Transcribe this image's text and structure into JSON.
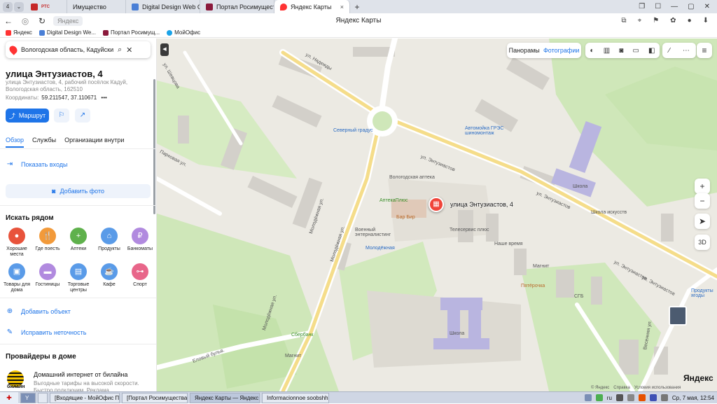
{
  "browser": {
    "tabs": [
      {
        "label": "",
        "badge": "PTC",
        "active": false
      },
      {
        "label": "Имущество",
        "active": false
      },
      {
        "label": "Digital Design Web Client",
        "active": false
      },
      {
        "label": "Портал Росимущества",
        "active": false
      },
      {
        "label": "Яндекс Карты",
        "active": true
      }
    ],
    "new_tab": "+",
    "site_chip": "Яндекс",
    "page_title": "Яндекс Карты",
    "bookmarks": [
      "Яндекс",
      "Digital Design We...",
      "Портал Росимущ...",
      "МойОфис"
    ]
  },
  "search": {
    "value": "Вологодская область, Кадуйский ра"
  },
  "place": {
    "title": "улица Энтузиастов, 4",
    "address": "улица Энтузиастов, 4, рабочий посёлок Кадуй, Вологодская область, 162510",
    "coords_label": "Координаты:",
    "coords_value": "59.211547, 37.110671",
    "more": "•••",
    "route_label": "Маршрут"
  },
  "tabs": [
    "Обзор",
    "Службы",
    "Организации внутри"
  ],
  "actions": {
    "show_entrances": "Показать входы",
    "add_photo": "Добавить фото",
    "add_object": "Добавить объект",
    "fix_error": "Исправить неточность"
  },
  "nearby": {
    "title": "Искать рядом",
    "categories": [
      {
        "label": "Хорошие места",
        "icon": "map-pin-icon",
        "color": "#e8533b"
      },
      {
        "label": "Где поесть",
        "icon": "food-icon",
        "color": "#f29a3a"
      },
      {
        "label": "Аптеки",
        "icon": "pharmacy-icon",
        "color": "#5fb14c"
      },
      {
        "label": "Продукты",
        "icon": "basket-icon",
        "color": "#5a9be8"
      },
      {
        "label": "Банкоматы",
        "icon": "ruble-icon",
        "color": "#b18adf"
      },
      {
        "label": "Товары для дома",
        "icon": "bag-icon",
        "color": "#5a9be8"
      },
      {
        "label": "Гостиницы",
        "icon": "bed-icon",
        "color": "#b18adf"
      },
      {
        "label": "Торговые центры",
        "icon": "mall-icon",
        "color": "#5a9be8"
      },
      {
        "label": "Кафе",
        "icon": "cup-icon",
        "color": "#5a9be8"
      },
      {
        "label": "Спорт",
        "icon": "dumbbell-icon",
        "color": "#e8668a"
      }
    ]
  },
  "providers": {
    "title": "Провайдеры в доме",
    "name": "Домашний интернет от билайна",
    "logo_text": "билайн",
    "desc": "Выгодные тарифы на высокой скорости. Быстро подключим. Реклама."
  },
  "map": {
    "layers": [
      "Панорамы",
      "Фотографии"
    ],
    "zoom_in": "+",
    "zoom_out": "−",
    "mode_3d": "3D",
    "selected_label": "улица Энтузиастов, 4",
    "brand": "Яндекс",
    "footer": [
      "© Яндекс",
      "Справка",
      "Условия использования"
    ],
    "streets": [
      {
        "text": "ул. Энтузиастов",
        "key": "s1"
      },
      {
        "text": "ул. Энтузиастов",
        "key": "s2"
      },
      {
        "text": "ул. Энтузиастов",
        "key": "s3"
      },
      {
        "text": "ул. Энтузиастов",
        "key": "s4"
      },
      {
        "text": "Молодёжная ул.",
        "key": "s5"
      },
      {
        "text": "Молодёжная ул.",
        "key": "s6"
      },
      {
        "text": "Молодёжная ул.",
        "key": "s7"
      },
      {
        "text": "Парковая ул.",
        "key": "s8"
      },
      {
        "text": "Еловый бульв.",
        "key": "s9"
      },
      {
        "text": "ул. Надежды",
        "key": "s10"
      },
      {
        "text": "Весенняя ул.",
        "key": "s11"
      },
      {
        "text": "ул. Шевцова",
        "key": "s12"
      }
    ],
    "pois": [
      {
        "text": "Северный градус",
        "key": "p1"
      },
      {
        "text": "Автомойка ГРЭС шиномонтаж",
        "key": "p2"
      },
      {
        "text": "Вологодская аптека",
        "key": "p3"
      },
      {
        "text": "АптекаПлюс",
        "key": "p4"
      },
      {
        "text": "Бар Бир",
        "key": "p5"
      },
      {
        "text": "Военный энтерналистинг",
        "key": "p6"
      },
      {
        "text": "Молодёжная",
        "key": "p7"
      },
      {
        "text": "Телесервис плюс",
        "key": "p8"
      },
      {
        "text": "Наше время",
        "key": "p9"
      },
      {
        "text": "Магнит",
        "key": "p10"
      },
      {
        "text": "Пятёрочка",
        "key": "p11"
      },
      {
        "text": "СГБ",
        "key": "p12"
      },
      {
        "text": "Школа",
        "key": "p13"
      },
      {
        "text": "Школа искусств",
        "key": "p14"
      },
      {
        "text": "Сбербанк",
        "key": "p15"
      },
      {
        "text": "Школа",
        "key": "p16"
      },
      {
        "text": "Магнит",
        "key": "p17"
      },
      {
        "text": "Продукты ягоды",
        "key": "p18"
      }
    ]
  },
  "taskbar": {
    "items": [
      "[Входящие - МойОфис П...",
      "[Портал Росимущества - ...",
      "Яндекс Карты — Яндекс ...",
      "Informacionnoe soobshhe..."
    ],
    "lang": "ru",
    "clock": "Ср, 7 мая, 12:54"
  }
}
